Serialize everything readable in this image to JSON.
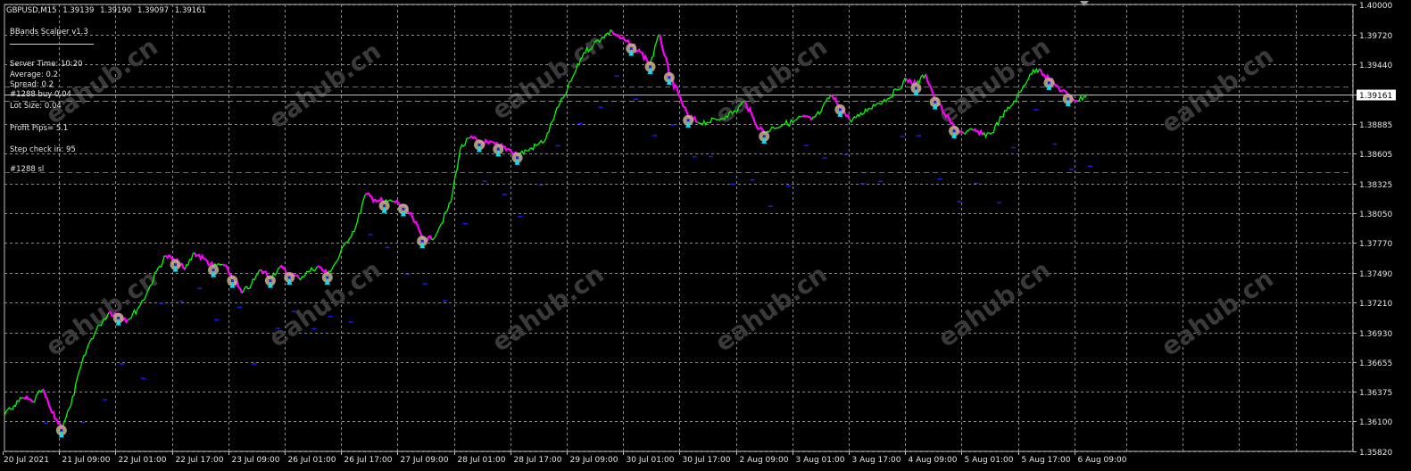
{
  "header": {
    "symbol": "GBPUSD,M15",
    "open": "1.39139",
    "high": "1.39190",
    "low": "1.39097",
    "close": "1.39161"
  },
  "overlay": {
    "ea_name": "BBands Scalper v1.3",
    "server_time": "Server Time: 10:20",
    "average": "Average: 0.2",
    "spread": "Spread: 0.2",
    "order_buy": "#1288 buy 0.04",
    "lot_size": "Lot Size:  0.04",
    "profit_pips": "Profit Pips= 5.1",
    "step_check": "Step check in: 95",
    "order_sl": "#1288 sl"
  },
  "watermark": "eahub.cn",
  "colors": {
    "background": "#000000",
    "grid": "#8a8a8a",
    "bull": "#00ff00",
    "bear": "#ff00ff",
    "sell_arrow": "#00e5ff",
    "trade_circle": "#c8b48c",
    "dash_red": "#ff2a2a",
    "dash_green": "#3cbb3c",
    "price_line": "#c0c0c0",
    "blue_dots": "#1a1aff"
  },
  "price_labels": [
    "1.40000",
    "1.39720",
    "1.39440",
    "1.39161",
    "1.38885",
    "1.38605",
    "1.38325",
    "1.38050",
    "1.37770",
    "1.37490",
    "1.37210",
    "1.36930",
    "1.36655",
    "1.36375",
    "1.36100",
    "1.35820"
  ],
  "time_labels": [
    "20 Jul 2021",
    "21 Jul 09:00",
    "22 Jul 01:00",
    "22 Jul 17:00",
    "23 Jul 09:00",
    "26 Jul 01:00",
    "26 Jul 17:00",
    "27 Jul 09:00",
    "28 Jul 01:00",
    "28 Jul 17:00",
    "29 Jul 09:00",
    "30 Jul 01:00",
    "30 Jul 17:00",
    "2 Aug 09:00",
    "3 Aug 01:00",
    "3 Aug 17:00",
    "4 Aug 09:00",
    "5 Aug 01:00",
    "5 Aug 17:00",
    "6 Aug 09:00"
  ],
  "chart_data": {
    "type": "line",
    "symbol": "GBPUSD",
    "timeframe": "M15",
    "ylim": [
      1.3582,
      1.4
    ],
    "current_price": 1.39161,
    "grid": true,
    "levels": [
      {
        "name": "red-dash-upper",
        "value": 1.3923
      },
      {
        "name": "green-dash",
        "value": 1.391
      },
      {
        "name": "red-dash-lower",
        "value": 1.3843
      }
    ],
    "series": [
      {
        "values": [
          1.3615,
          1.3625,
          1.3632,
          1.3628,
          1.364,
          1.3618,
          1.3605,
          1.3625,
          1.366,
          1.3685,
          1.37,
          1.3712,
          1.371,
          1.3705,
          1.3715,
          1.373,
          1.375,
          1.3765,
          1.376,
          1.3752,
          1.3768,
          1.3762,
          1.3755,
          1.3757,
          1.3745,
          1.373,
          1.3738,
          1.3752,
          1.3745,
          1.3754,
          1.3748,
          1.3744,
          1.375,
          1.3755,
          1.3748,
          1.376,
          1.3778,
          1.3792,
          1.3822,
          1.3818,
          1.3815,
          1.3816,
          1.3812,
          1.38,
          1.3782,
          1.378,
          1.3795,
          1.3815,
          1.3865,
          1.3875,
          1.3872,
          1.387,
          1.3868,
          1.3865,
          1.386,
          1.3863,
          1.3868,
          1.3874,
          1.3898,
          1.3915,
          1.3935,
          1.3955,
          1.3962,
          1.397,
          1.3975,
          1.3968,
          1.3962,
          1.3955,
          1.3945,
          1.3972,
          1.3935,
          1.3915,
          1.3895,
          1.389,
          1.389,
          1.3892,
          1.3896,
          1.39,
          1.391,
          1.389,
          1.388,
          1.3885,
          1.3888,
          1.389,
          1.3895,
          1.3892,
          1.39,
          1.3915,
          1.3905,
          1.3892,
          1.3895,
          1.3903,
          1.3908,
          1.3912,
          1.392,
          1.393,
          1.3925,
          1.3935,
          1.3912,
          1.3898,
          1.3885,
          1.388,
          1.3882,
          1.3878,
          1.388,
          1.3895,
          1.3905,
          1.3918,
          1.3935,
          1.394,
          1.393,
          1.3922,
          1.3915,
          1.391,
          1.3916
        ]
      }
    ]
  }
}
